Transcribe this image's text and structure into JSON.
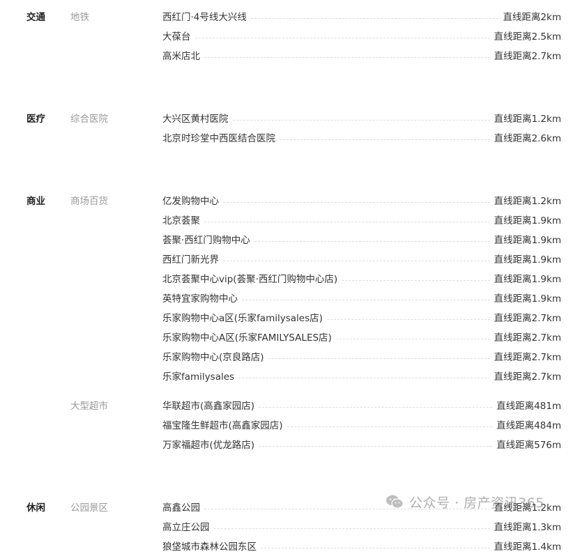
{
  "sections": [
    {
      "category": "交通",
      "groups": [
        {
          "subcategory": "地铁",
          "items": [
            {
              "name": "西红门·4号线大兴线",
              "distance": "直线距离2km"
            },
            {
              "name": "大葆台",
              "distance": "直线距离2.5km"
            },
            {
              "name": "高米店北",
              "distance": "直线距离2.7km"
            }
          ]
        }
      ]
    },
    {
      "category": "医疗",
      "groups": [
        {
          "subcategory": "综合医院",
          "items": [
            {
              "name": "大兴区黄村医院",
              "distance": "直线距离1.2km"
            },
            {
              "name": "北京时珍堂中西医结合医院",
              "distance": "直线距离2.6km"
            }
          ]
        }
      ]
    },
    {
      "category": "商业",
      "groups": [
        {
          "subcategory": "商场百货",
          "items": [
            {
              "name": "亿发购物中心",
              "distance": "直线距离1.2km"
            },
            {
              "name": "北京荟聚",
              "distance": "直线距离1.9km"
            },
            {
              "name": "荟聚·西红门购物中心",
              "distance": "直线距离1.9km"
            },
            {
              "name": "西红门新光界",
              "distance": "直线距离1.9km"
            },
            {
              "name": "北京荟聚中心vip(荟聚·西红门购物中心店)",
              "distance": "直线距离1.9km"
            },
            {
              "name": "英特宜家购物中心",
              "distance": "直线距离1.9km"
            },
            {
              "name": "乐家购物中心a区(乐家familysales店)",
              "distance": "直线距离2.7km"
            },
            {
              "name": "乐家购物中心A区(乐家FAMILYSALES店)",
              "distance": "直线距离2.7km"
            },
            {
              "name": "乐家购物中心(京良路店)",
              "distance": "直线距离2.7km"
            },
            {
              "name": "乐家familysales",
              "distance": "直线距离2.7km"
            }
          ]
        },
        {
          "subcategory": "大型超市",
          "items": [
            {
              "name": "华联超市(高鑫家园店)",
              "distance": "直线距离481m"
            },
            {
              "name": "福宝隆生鲜超市(高鑫家园店)",
              "distance": "直线距离484m"
            },
            {
              "name": "万家福超市(优龙路店)",
              "distance": "直线距离576m"
            }
          ]
        }
      ]
    },
    {
      "category": "休闲",
      "groups": [
        {
          "subcategory": "公园景区",
          "items": [
            {
              "name": "高鑫公园",
              "distance": "直线距离1.2km"
            },
            {
              "name": "高立庄公园",
              "distance": "直线距离1.3km"
            },
            {
              "name": "狼垡城市森林公园东区",
              "distance": "直线距离1.4km"
            }
          ]
        }
      ]
    }
  ],
  "watermark": {
    "text": "公众号 · 房产资讯365",
    "icon": "wechat-icon"
  }
}
